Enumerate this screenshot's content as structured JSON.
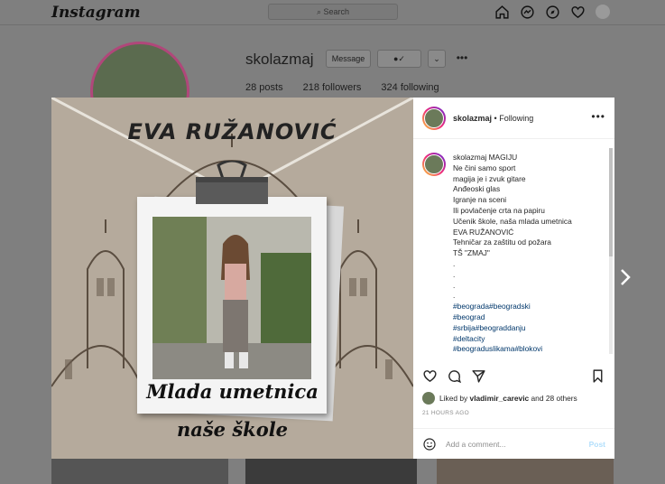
{
  "app": {
    "logo_text": "Instagram",
    "search_placeholder": "Search",
    "nav_icons": [
      "home-icon",
      "messenger-icon",
      "explore-icon",
      "heart-icon",
      "profile-avatar"
    ]
  },
  "profile": {
    "username": "skolazmaj",
    "message_label": "Message",
    "posts": "28 posts",
    "followers": "218 followers",
    "following": "324 following"
  },
  "post": {
    "image_title": "EVA RUŽANOVIĆ",
    "image_script_line1": "Mlada umetnica",
    "image_script_line2": "naše škole",
    "header_username": "skolazmaj",
    "header_separator": "•",
    "header_following": "Following",
    "caption_username": "skolazmaj",
    "caption_first": "MAGIJU",
    "caption_lines": [
      "Ne čini samo sport",
      "magija je i zvuk gitare",
      "Anđeoski glas",
      "Igranje na sceni",
      "Ili povlačenje crta na papiru",
      "Učenik škole, naša mlada umetnica",
      "EVA RUŽANOVIĆ",
      "Tehničar za zaštitu od požara",
      "TŠ \"ZMAJ\"",
      ".",
      ".",
      ".",
      "."
    ],
    "hashtags": [
      "#beograda#beogradski",
      "#beograd",
      "#srbija#beograddanju",
      "#deltacity",
      "#beograduslikama#blokovi"
    ],
    "liked_by_prefix": "Liked by",
    "liked_by_user": "vladimir_carevic",
    "liked_by_suffix": "and 28 others",
    "time_ago": "21 HOURS AGO",
    "comment_placeholder": "Add a comment...",
    "post_label": "Post"
  },
  "colors": {
    "link_blue": "#00376b",
    "post_button_disabled": "#b2dffc",
    "overlay_gray": "#7f7f7f"
  }
}
